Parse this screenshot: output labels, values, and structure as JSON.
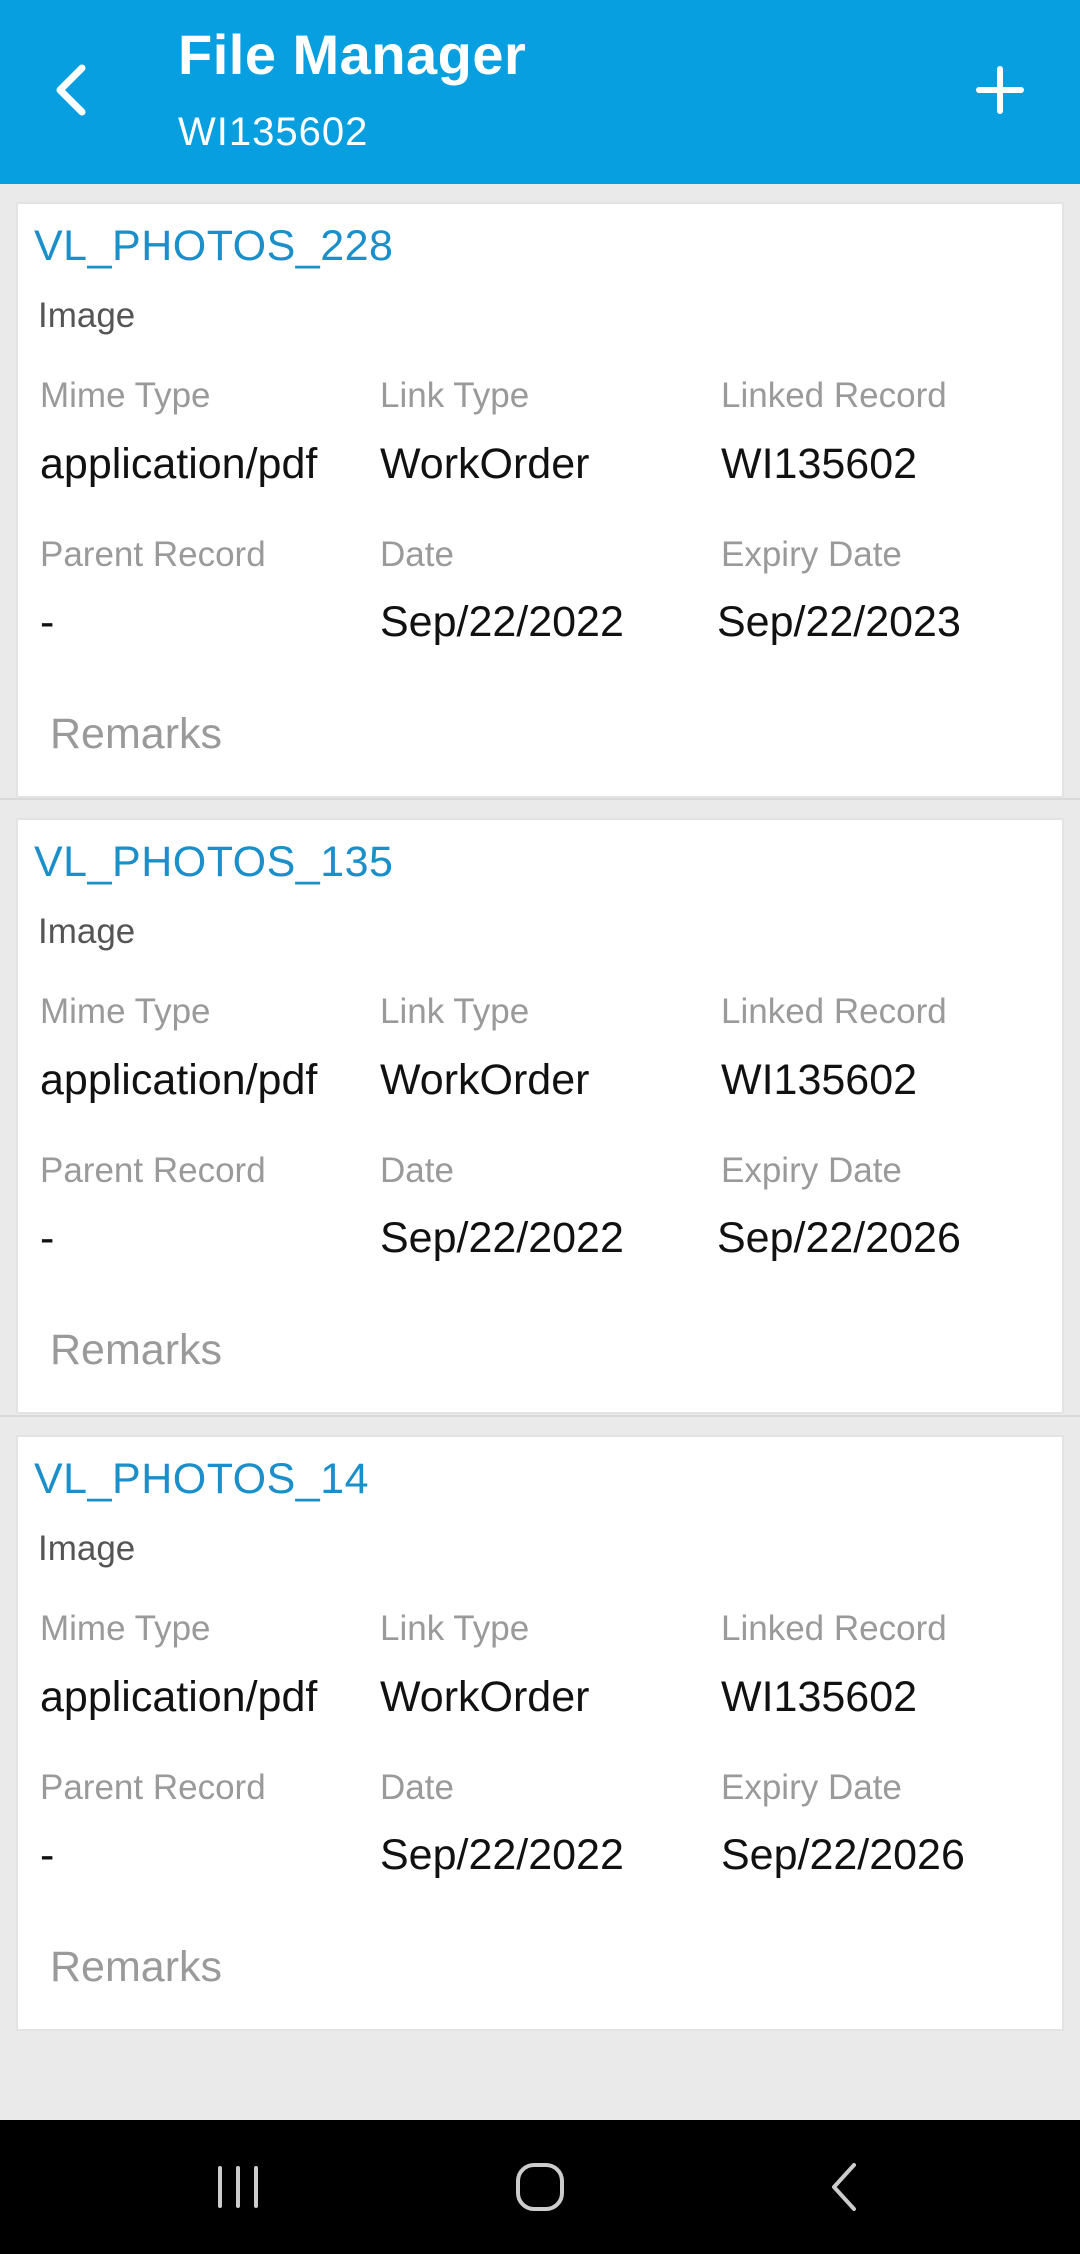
{
  "colors": {
    "header_bg": "#079fe0",
    "title_color": "#1a8fc9"
  },
  "header": {
    "title": "File Manager",
    "subtitle": "WI135602",
    "back_icon": "chevron-left-icon",
    "add_icon": "plus-icon"
  },
  "labels": {
    "mime_type": "Mime Type",
    "link_type": "Link Type",
    "linked_record": "Linked Record",
    "parent_record": "Parent Record",
    "date": "Date",
    "expiry_date": "Expiry Date",
    "remarks": "Remarks"
  },
  "files": [
    {
      "name": "VL_PHOTOS_228",
      "category": "Image",
      "mime_type": "application/pdf",
      "link_type": "WorkOrder",
      "linked_record": "WI135602",
      "parent_record": "-",
      "date": "Sep/22/2022",
      "expiry_date": "Sep/22/2023"
    },
    {
      "name": "VL_PHOTOS_135",
      "category": "Image",
      "mime_type": "application/pdf",
      "link_type": "WorkOrder",
      "linked_record": "WI135602",
      "parent_record": "-",
      "date": "Sep/22/2022",
      "expiry_date": "Sep/22/2026"
    },
    {
      "name": "VL_PHOTOS_14",
      "category": "Image",
      "mime_type": "application/pdf",
      "link_type": "WorkOrder",
      "linked_record": "WI135602",
      "parent_record": "-",
      "date": "Sep/22/2022",
      "expiry_date": "Sep/22/2026"
    }
  ],
  "navigation_bar": {
    "recents_icon": "recent-apps-icon",
    "home_icon": "home-icon",
    "back_icon": "back-icon"
  }
}
